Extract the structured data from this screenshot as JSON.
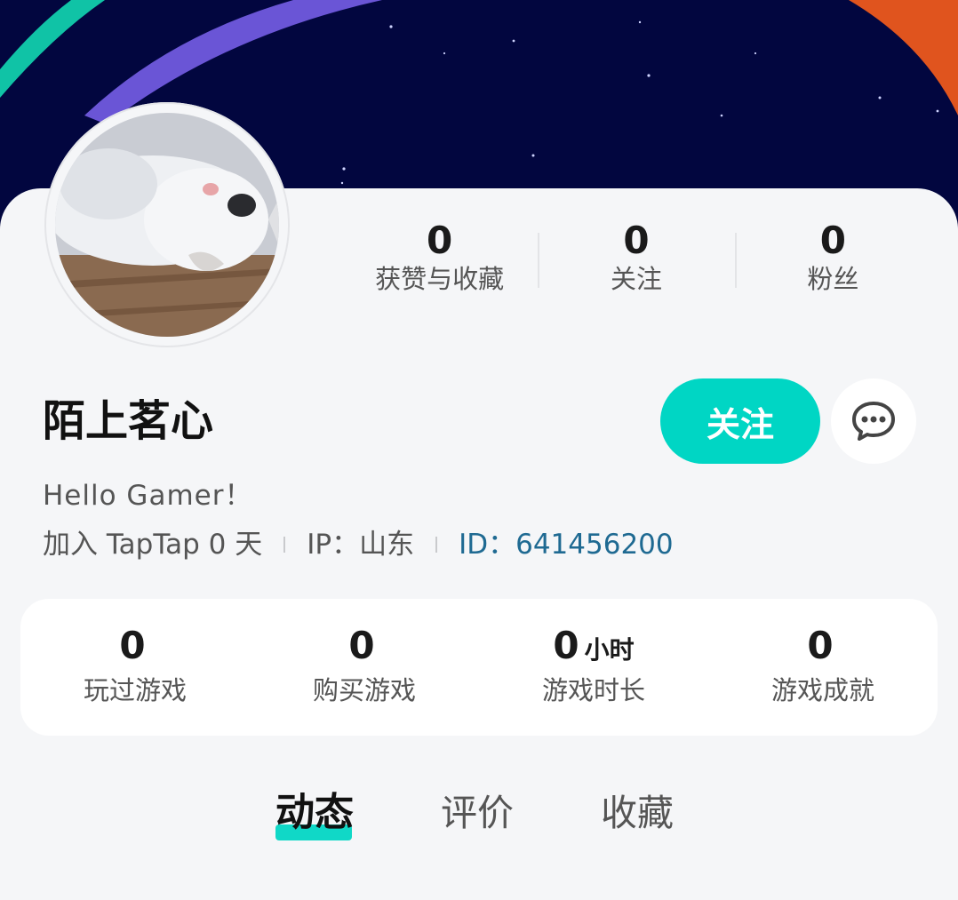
{
  "profile": {
    "username": "陌上茗心",
    "bio": "Hello Gamer！",
    "join_text": "加入 TapTap 0 天",
    "ip_text": "IP：山东",
    "id_text": "ID：641456200"
  },
  "stats": [
    {
      "value": "0",
      "label": "获赞与收藏"
    },
    {
      "value": "0",
      "label": "关注"
    },
    {
      "value": "0",
      "label": "粉丝"
    }
  ],
  "actions": {
    "follow_label": "关注"
  },
  "game_stats": [
    {
      "value": "0",
      "unit": "",
      "label": "玩过游戏"
    },
    {
      "value": "0",
      "unit": "",
      "label": "购买游戏"
    },
    {
      "value": "0",
      "unit": "小时",
      "label": "游戏时长"
    },
    {
      "value": "0",
      "unit": "",
      "label": "游戏成就"
    }
  ],
  "tabs": [
    {
      "label": "动态",
      "active": true
    },
    {
      "label": "评价",
      "active": false
    },
    {
      "label": "收藏",
      "active": false
    }
  ],
  "colors": {
    "banner_bg": "#02063f",
    "accent": "#00d6c4",
    "id_link": "#1f6a92",
    "stripe_purple": "#6a55d6",
    "stripe_teal": "#10c3a6",
    "stripe_orange": "#e0541e"
  },
  "icons": {
    "message": "message-bubble-icon"
  }
}
